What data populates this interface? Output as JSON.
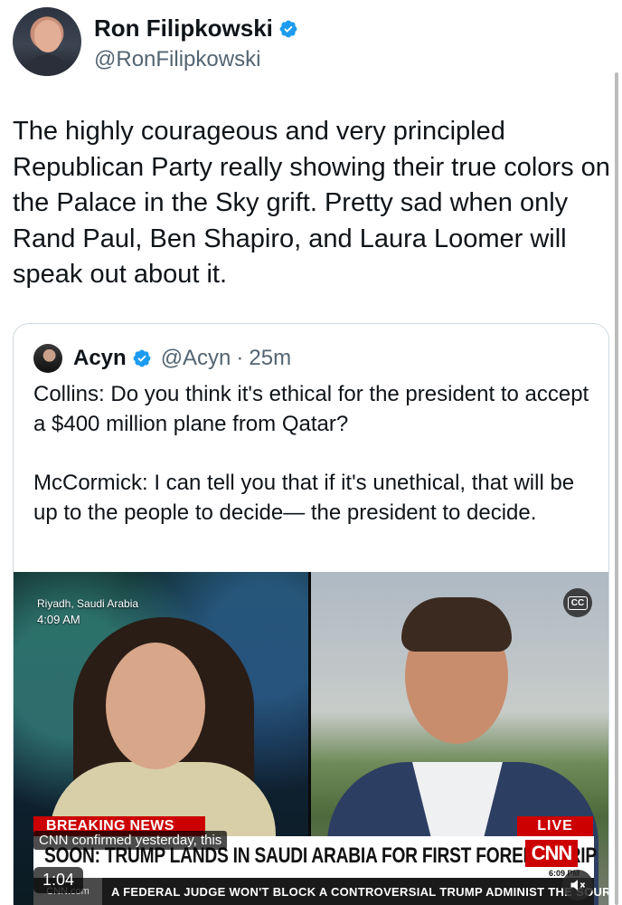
{
  "post": {
    "author_name": "Ron Filipkowski",
    "author_handle": "@RonFilipkowski",
    "text_lines": [
      "The highly courageous and very principled",
      "Republican Party really showing their true colors on",
      "the Palace in the Sky grift. Pretty sad when only",
      "Rand Paul, Ben Shapiro, and Laura Loomer will",
      "speak out about it."
    ]
  },
  "quote": {
    "author_name": "Acyn",
    "author_handle": "@Acyn",
    "separator": "·",
    "time": "25m",
    "paragraphs": [
      "Collins: Do you think it's ethical for the president to accept a $400 million plane from Qatar?",
      "McCormick: I can tell you that if it's unethical, that will be up to the people to decide— the president to decide."
    ]
  },
  "video": {
    "location": "Riyadh, Saudi Arabia",
    "location_time": "4:09 AM",
    "cc_label": "CC",
    "breaking_label": "BREAKING NEWS",
    "live_label": "LIVE",
    "headline": "SOON: TRUMP LANDS IN SAUDI ARABIA FOR FIRST FOREIGN TRIP",
    "network_logo": "CNN",
    "clock": "6:09 PM",
    "ticker_logo": "CNN.com",
    "ticker": "A FEDERAL JUDGE WON'T BLOCK A CONTROVERSIAL TRUMP ADMINIST",
    "ticker_tail": "THE SOURCE",
    "caption": "CNN confirmed yesterday, this",
    "duration": "1:04"
  },
  "colors": {
    "verified_blue": "#1d9bf0",
    "cnn_red": "#cc0000",
    "muted_text": "#536471",
    "border": "#cfd9de"
  },
  "icons": {
    "verified": "verified-badge-icon",
    "cc": "closed-captions-icon",
    "mute": "speaker-muted-icon"
  }
}
